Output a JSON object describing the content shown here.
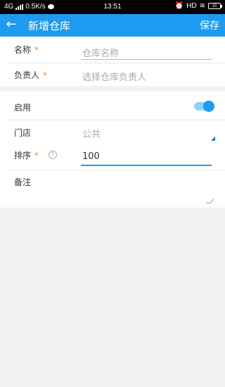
{
  "statusbar": {
    "network": "4G",
    "speed": "0.5K/s",
    "time": "13:51",
    "hd": "HD",
    "battery": "15"
  },
  "appbar": {
    "title": "新增仓库",
    "save_label": "保存"
  },
  "form": {
    "name": {
      "label": "名称",
      "required": "*",
      "placeholder": "仓库名称"
    },
    "manager": {
      "label": "负责人",
      "required": "*",
      "placeholder": "选择仓库负责人"
    },
    "enabled": {
      "label": "启用",
      "value": true
    },
    "store": {
      "label": "门店",
      "value": "公共"
    },
    "sort": {
      "label": "排序",
      "required": "*",
      "value": "100"
    },
    "remark": {
      "label": "备注",
      "value": ""
    }
  },
  "colors": {
    "primary": "#1e9bf0",
    "required": "#f08a24"
  }
}
